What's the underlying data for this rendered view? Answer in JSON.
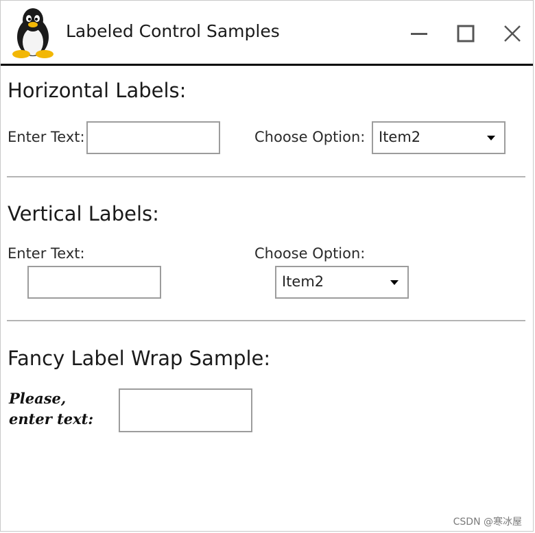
{
  "window": {
    "title": "Labeled Control Samples"
  },
  "icons": {
    "app": "linux-penguin-icon",
    "minimize": "minimize-icon",
    "maximize": "maximize-icon",
    "close": "close-icon",
    "dropdown": "chevron-down-icon"
  },
  "horizontal": {
    "title": "Horizontal Labels:",
    "text_label": "Enter Text:",
    "text_value": "",
    "option_label": "Choose Option:",
    "option_value": "Item2"
  },
  "vertical": {
    "title": "Vertical Labels:",
    "text_label": "Enter Text:",
    "text_value": "",
    "option_label": "Choose Option:",
    "option_value": "Item2"
  },
  "fancy": {
    "title": "Fancy Label Wrap Sample:",
    "label": "Please, enter text:",
    "text_value": ""
  },
  "watermark": "CSDN @寒冰屋",
  "colors": {
    "title_rule": "#000000",
    "separator": "#b4b4b4",
    "control_border": "#9c9c9c"
  }
}
